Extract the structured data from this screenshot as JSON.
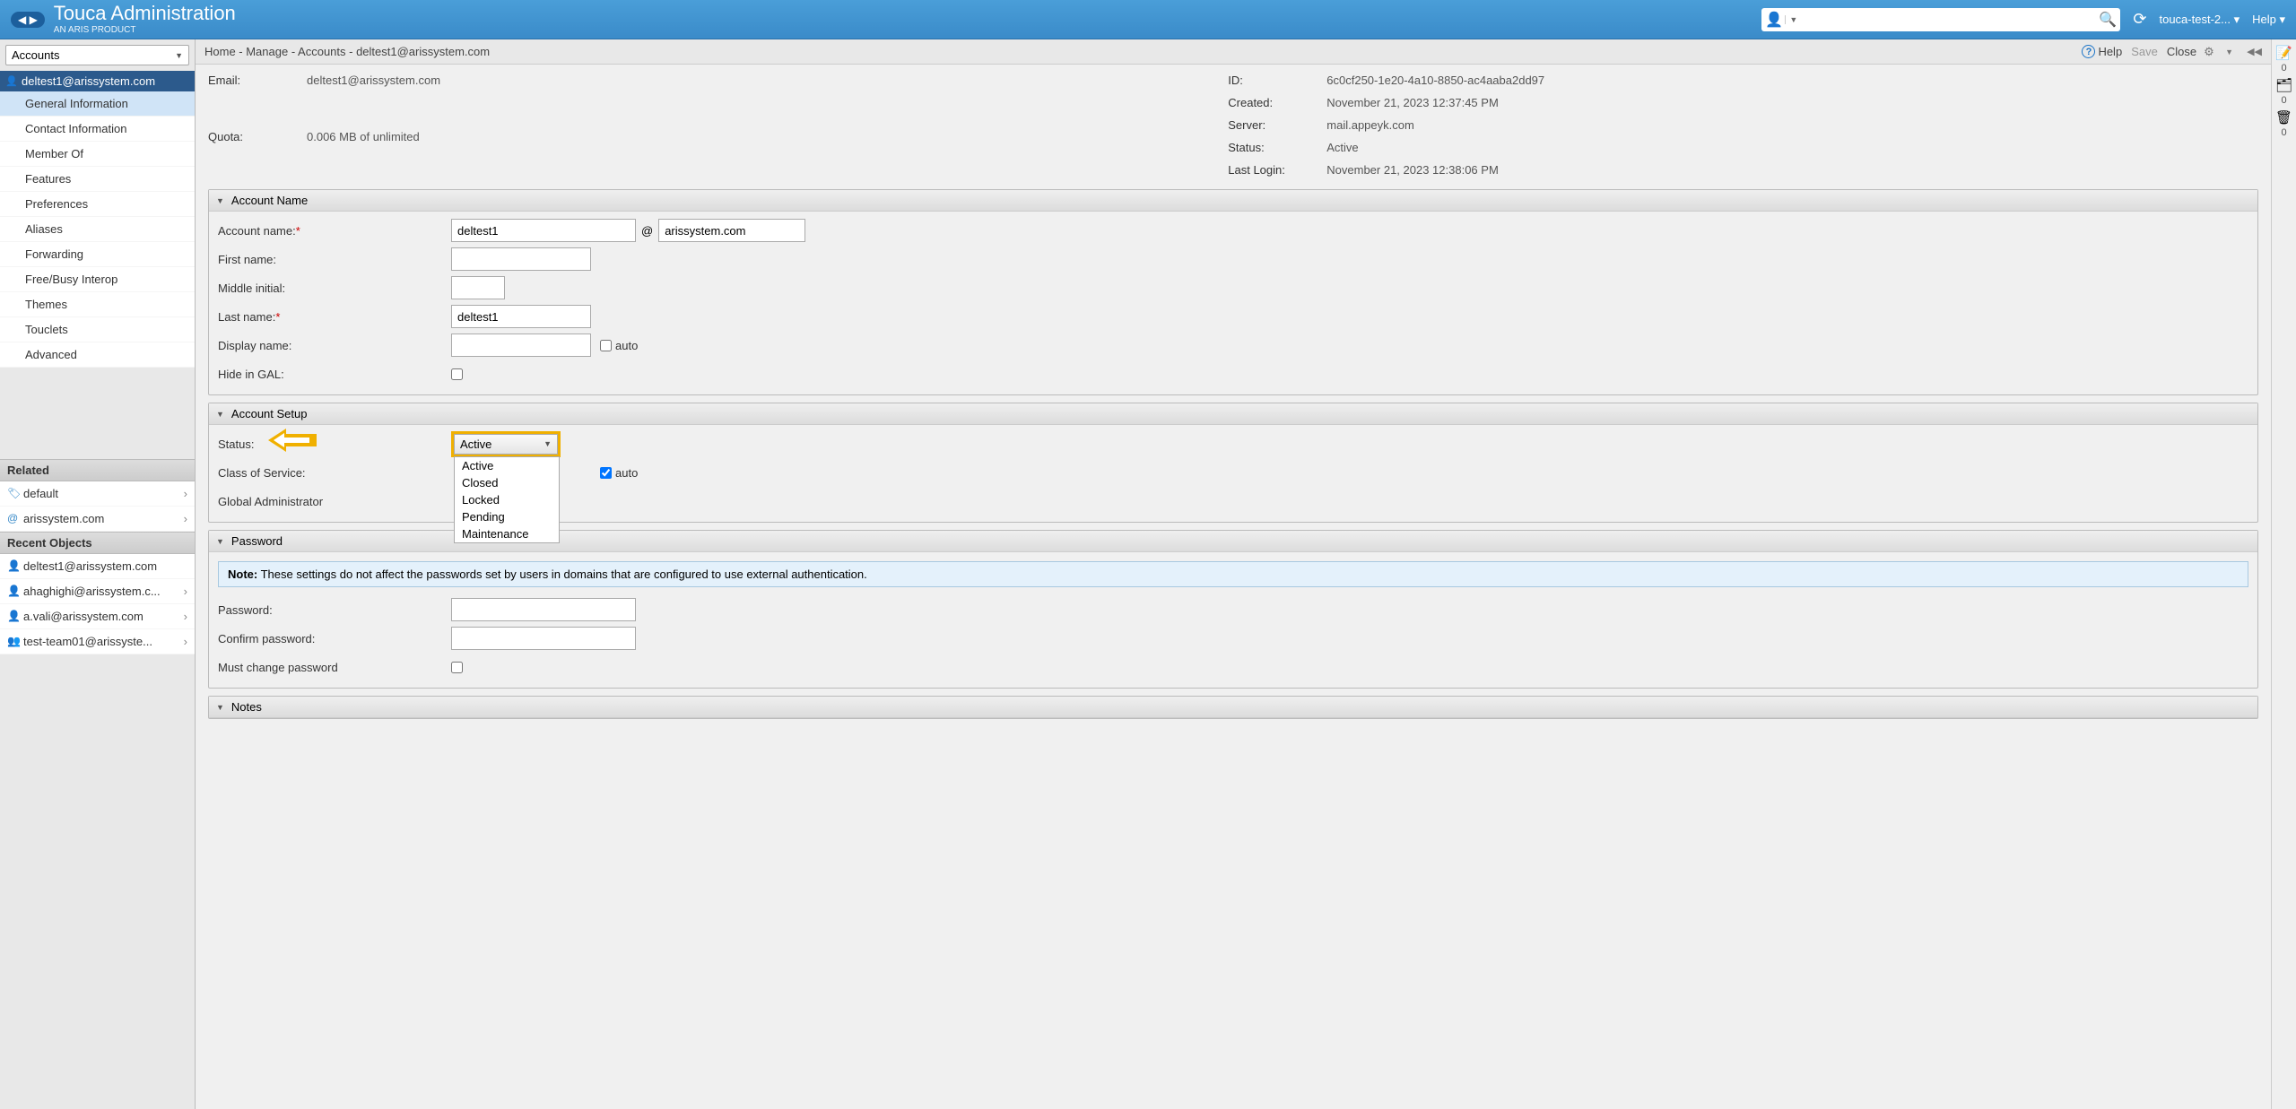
{
  "header": {
    "brand_title": "Touca Administration",
    "brand_sub": "AN ARIS PRODUCT",
    "user_dd": "touca-test-2...",
    "help_label": "Help"
  },
  "sidebar": {
    "tree_select_label": "Accounts",
    "tree_item": "deltest1@arissystem.com",
    "nav_items": [
      "General Information",
      "Contact Information",
      "Member Of",
      "Features",
      "Preferences",
      "Aliases",
      "Forwarding",
      "Free/Busy Interop",
      "Themes",
      "Touclets",
      "Advanced"
    ],
    "active_nav_index": 0,
    "related_hdr": "Related",
    "related_items": [
      {
        "icon": "🏷",
        "label": "default"
      },
      {
        "icon": "@",
        "label": "arissystem.com"
      }
    ],
    "recent_hdr": "Recent Objects",
    "recent_items": [
      {
        "icon": "👤",
        "label": "deltest1@arissystem.com",
        "chev": false
      },
      {
        "icon": "👤",
        "label": "ahaghighi@arissystem.c...",
        "chev": true
      },
      {
        "icon": "👤",
        "label": "a.vali@arissystem.com",
        "chev": true
      },
      {
        "icon": "👥",
        "label": "test-team01@arissyste...",
        "chev": true
      }
    ]
  },
  "toolbar": {
    "breadcrumb": "Home - Manage - Accounts - deltest1@arissystem.com",
    "help_label": "Help",
    "save_label": "Save",
    "close_label": "Close"
  },
  "info": {
    "email_label": "Email:",
    "email_val": "deltest1@arissystem.com",
    "quota_label": "Quota:",
    "quota_val": "0.006 MB of unlimited",
    "id_label": "ID:",
    "id_val": "6c0cf250-1e20-4a10-8850-ac4aaba2dd97",
    "created_label": "Created:",
    "created_val": "November 21, 2023 12:37:45 PM",
    "server_label": "Server:",
    "server_val": "mail.appeyk.com",
    "status_label": "Status:",
    "status_val": "Active",
    "lastlogin_label": "Last Login:",
    "lastlogin_val": "November 21, 2023 12:38:06 PM"
  },
  "panels": {
    "account_name": {
      "title": "Account Name",
      "fields": {
        "account_name_label": "Account name:",
        "account_name_val": "deltest1",
        "domain_val": "arissystem.com",
        "first_name_label": "First name:",
        "middle_initial_label": "Middle initial:",
        "last_name_label": "Last name:",
        "last_name_val": "deltest1",
        "display_name_label": "Display name:",
        "auto_label1": "auto",
        "hide_gal_label": "Hide in GAL:"
      }
    },
    "account_setup": {
      "title": "Account Setup",
      "fields": {
        "status_label": "Status:",
        "status_selected": "Active",
        "status_options": [
          "Active",
          "Closed",
          "Locked",
          "Pending",
          "Maintenance"
        ],
        "cos_label": "Class of Service:",
        "auto_label2": "auto",
        "ga_label": "Global Administrator"
      }
    },
    "password": {
      "title": "Password",
      "note_label": "Note:",
      "note_text": " These settings do not affect the passwords set by users in domains that are configured to use external authentication.",
      "pw_label": "Password:",
      "confirm_label": "Confirm password:",
      "must_change_label": "Must change password"
    },
    "notes": {
      "title": "Notes"
    }
  },
  "rightRail": {
    "count0": "0",
    "count1": "0",
    "count2": "0"
  }
}
